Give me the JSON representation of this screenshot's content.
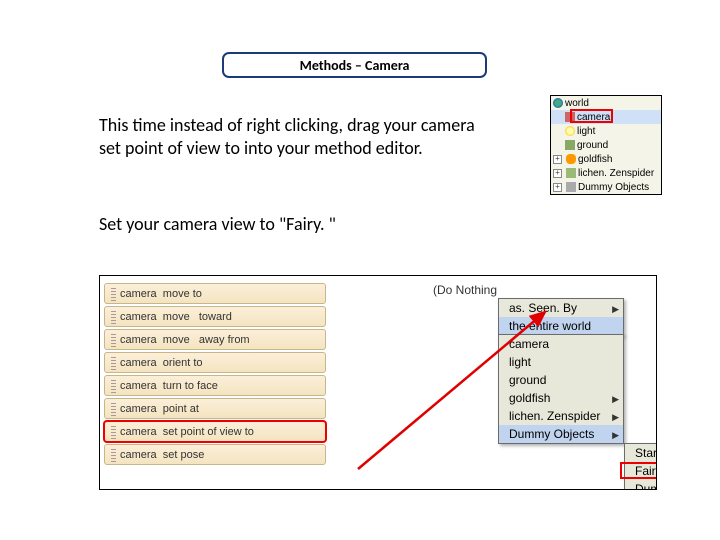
{
  "title": "Methods – Camera",
  "instruction1": "This time instead of right clicking, drag your camera set point of view to into your method editor.",
  "instruction2": "Set your camera view to \"Fairy. \"",
  "tree": {
    "world": "world",
    "camera": "camera",
    "light": "light",
    "ground": "ground",
    "goldfish": "goldfish",
    "lichen": "lichen. Zenspider",
    "dummy": "Dummy Objects"
  },
  "methods": [
    {
      "obj": "camera",
      "act": "move to"
    },
    {
      "obj": "camera",
      "act": "move",
      "arg": "toward"
    },
    {
      "obj": "camera",
      "act": "move",
      "arg": "away from"
    },
    {
      "obj": "camera",
      "act": "orient to"
    },
    {
      "obj": "camera",
      "act": "turn to face"
    },
    {
      "obj": "camera",
      "act": "point at"
    },
    {
      "obj": "camera",
      "act": "set point of view to"
    },
    {
      "obj": "camera",
      "act": "set pose"
    }
  ],
  "do_nothing": "(Do Nothing",
  "menu1": {
    "asSeenBy": "as. Seen. By",
    "entireWorld": "the entire world"
  },
  "menu2": {
    "camera": "camera",
    "light": "light",
    "ground": "ground",
    "goldfish": "goldfish",
    "lichen": "lichen. Zenspider",
    "dummy": "Dummy Objects"
  },
  "menu3": {
    "start": "Start",
    "fairy": "Fairy",
    "dummy": "Dummy"
  }
}
